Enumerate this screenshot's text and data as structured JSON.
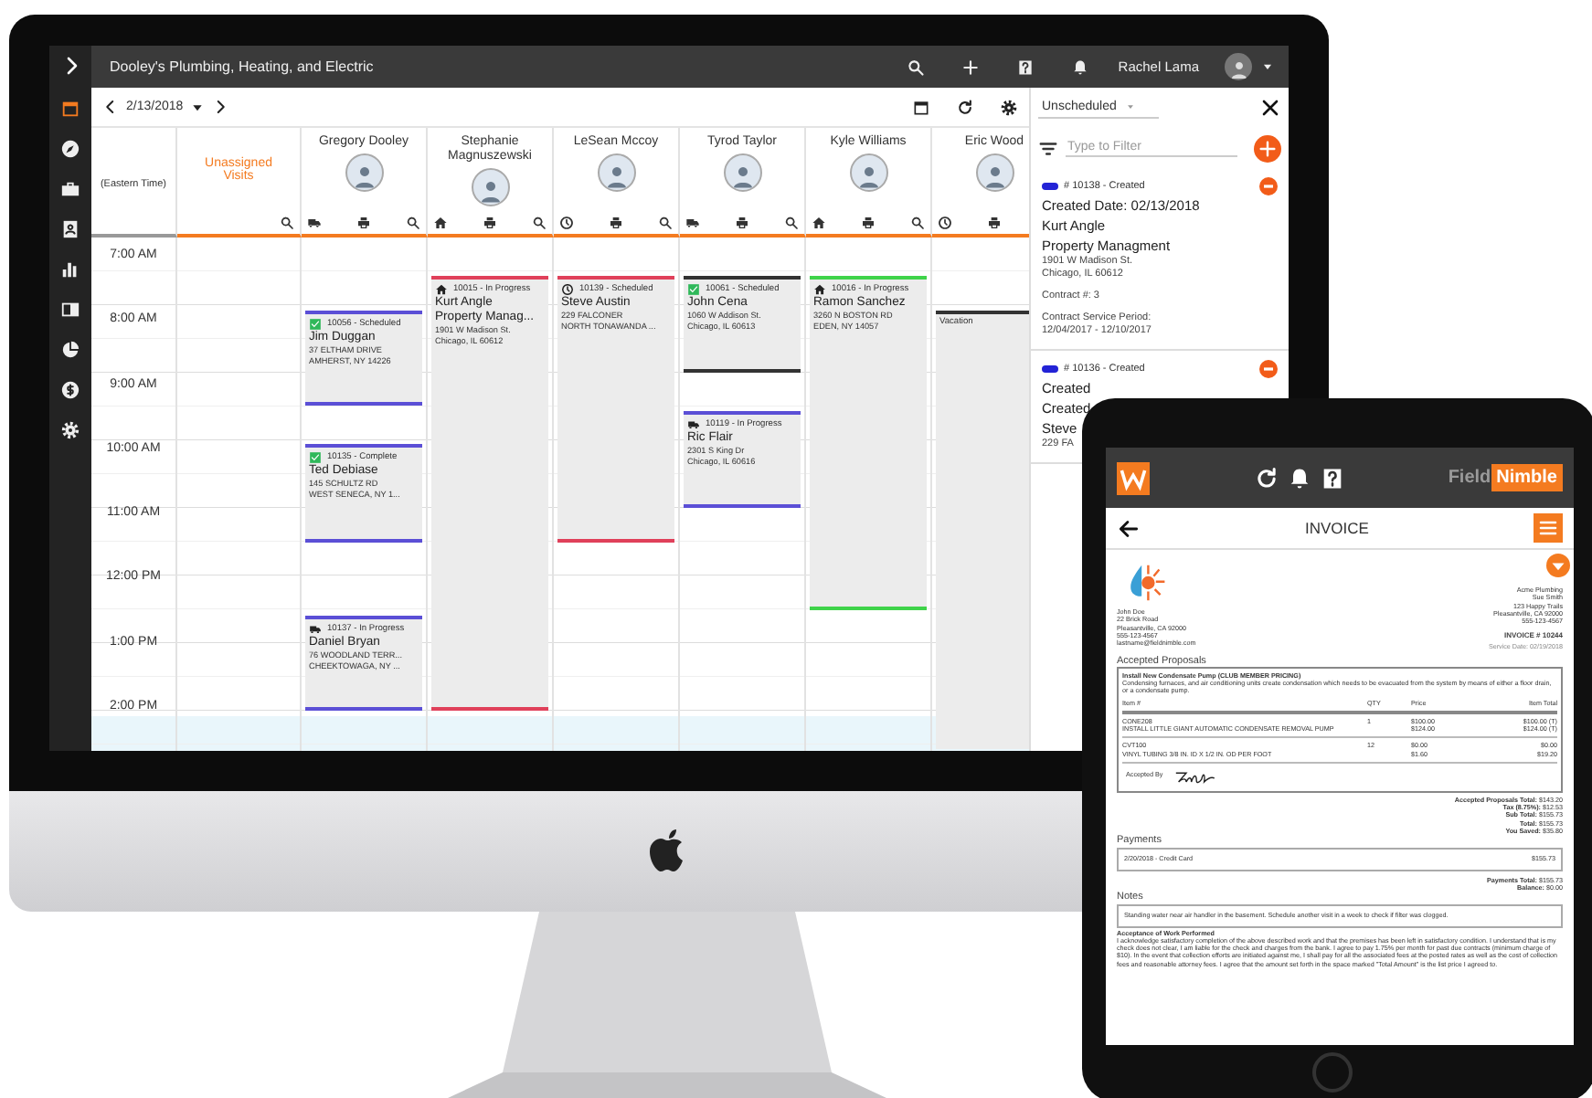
{
  "desktop": {
    "window": {
      "title": "Dooley's Plumbing, Heating, and Electric",
      "user": "Rachel Lama"
    },
    "sidebar": {
      "items": [
        {
          "kind": "calendar",
          "selected": true
        },
        {
          "kind": "compass",
          "selected": false
        },
        {
          "kind": "briefcase",
          "selected": false
        },
        {
          "kind": "contact",
          "selected": false
        },
        {
          "kind": "barchart",
          "selected": false
        },
        {
          "kind": "book",
          "selected": false
        },
        {
          "kind": "pie",
          "selected": false
        },
        {
          "kind": "dollar",
          "selected": false
        },
        {
          "kind": "gear",
          "selected": false
        }
      ]
    },
    "toolbar": {
      "date": "2/13/2018"
    },
    "calendar": {
      "time_header": "(Eastern Time)",
      "unassigned_header": "Unassigned Visits",
      "times": [
        "7:00 AM",
        "8:00 AM",
        "9:00 AM",
        "10:00 AM",
        "11:00 AM",
        "12:00 PM",
        "1:00 PM",
        "2:00 PM"
      ],
      "technicians": [
        {
          "name": "Gregory Dooley",
          "kind": "truck",
          "events": [
            {
              "kind": "check",
              "status": "10056 - Scheduled",
              "names": [
                "Jim Duggan"
              ],
              "lines": [
                "37 ELTHAM DRIVE",
                "AMHERST, NY 14226"
              ],
              "color": "#5b4fd6"
            },
            {
              "kind": "check",
              "status": "10135 - Complete",
              "names": [
                "Ted Debiase"
              ],
              "lines": [
                "145 SCHULTZ RD",
                "WEST SENECA, NY 1..."
              ],
              "color": "#5b4fd6"
            },
            {
              "kind": "truck",
              "status": "10137 - In Progress",
              "names": [
                "Daniel Bryan"
              ],
              "lines": [
                "76 WOODLAND TERR...",
                "CHEEKTOWAGA, NY ..."
              ],
              "color": "#5b4fd6"
            }
          ]
        },
        {
          "name": "Stephanie Magnuszewski",
          "kind": "house",
          "events": [
            {
              "kind": "house",
              "status": "10015 - In Progress",
              "names": [
                "Kurt Angle",
                "Property Manag..."
              ],
              "lines": [
                "1901 W Madison St.",
                "Chicago, IL 60612"
              ],
              "color": "#e0405a"
            }
          ]
        },
        {
          "name": "LeSean Mccoy",
          "kind": "clock",
          "events": [
            {
              "kind": "clock",
              "status": "10139 - Scheduled",
              "names": [
                "Steve Austin"
              ],
              "lines": [
                "229 FALCONER",
                "NORTH TONAWANDA ..."
              ],
              "color": "#e0405a"
            }
          ]
        },
        {
          "name": "Tyrod Taylor",
          "kind": "truck",
          "events": [
            {
              "kind": "check",
              "status": "10061 - Scheduled",
              "names": [
                "John Cena"
              ],
              "lines": [
                "1060 W Addison St.",
                "Chicago, IL 60613"
              ],
              "color": "#333333"
            },
            {
              "kind": "truck",
              "status": "10119 - In Progress",
              "names": [
                "Ric Flair"
              ],
              "lines": [
                "2301 S King Dr",
                "Chicago, IL 60616"
              ],
              "color": "#5b4fd6"
            }
          ]
        },
        {
          "name": "Kyle Williams",
          "kind": "house",
          "events": [
            {
              "kind": "house",
              "status": "10016 - In Progress",
              "names": [
                "Ramon Sanchez"
              ],
              "lines": [
                "3260 N BOSTON RD",
                "EDEN, NY 14057"
              ],
              "color": "#3fd34a"
            }
          ]
        },
        {
          "name": "Eric Wood",
          "kind": "clock",
          "events": [
            {
              "kind": "note",
              "status": "Vacation",
              "color": "#333333"
            }
          ]
        }
      ]
    },
    "panel": {
      "filter": "Unscheduled",
      "search": {
        "placeholder": "Type to Filter"
      },
      "cards": [
        {
          "number": "# 10138 - Created",
          "lines": [
            "Created Date: 02/13/2018",
            "Kurt Angle",
            "Property Managment"
          ],
          "address": [
            "1901 W Madison St.",
            "Chicago, IL 60612"
          ],
          "contract": "Contract #: 3",
          "period": [
            "Contract Service Period:",
            "12/04/2017 - 12/10/2017"
          ]
        },
        {
          "number": "# 10136 - Created",
          "lines": [
            "Created",
            "Created",
            "Steve"
          ],
          "address": [
            "229 FA"
          ]
        }
      ]
    }
  },
  "tablet": {
    "brand": [
      "Field",
      "Nimble"
    ],
    "title": "INVOICE",
    "customer": [
      "John Doe",
      "22 Brick Road",
      "Pleasantville, CA 92000",
      "555-123-4567",
      "lastname@fieldnimble.com"
    ],
    "company": [
      "Acme Plumbing",
      "Sue Smith",
      "123 Happy Trails",
      "Pleasantville, CA 92000",
      "555-123-4567"
    ],
    "invoice_number": "INVOICE # 10244",
    "service_date": "Service Date: 02/19/2018",
    "proposals_heading": "Accepted Proposals",
    "proposal": {
      "title": "Install New Condensate Pump (CLUB MEMBER PRICING)",
      "description": "Condensing furnaces, and air conditioning units create condensation which needs to be evacuated from the system by means of either a floor drain, or a condensate pump.",
      "columns": [
        "Item #",
        "QTY",
        "Price",
        "Item Total"
      ],
      "rows": [
        {
          "item": [
            "CONE208",
            "INSTALL LITTLE GIANT AUTOMATIC CONDENSATE REMOVAL PUMP"
          ],
          "qty": "1",
          "price": [
            "$100.00",
            "$124.00"
          ],
          "total": [
            "$100.00 (T)",
            "$124.00 (T)"
          ]
        },
        {
          "item": [
            "CVT100",
            "VINYL TUBING 3/8 IN. ID X 1/2 IN. OD PER FOOT"
          ],
          "qty": "12",
          "price": [
            "$0.00",
            "$1.60"
          ],
          "total": [
            "$0.00",
            "$19.20"
          ]
        }
      ],
      "accepted_by": "Accepted By"
    },
    "totals": [
      {
        "label": "Accepted Proposals Total:",
        "value": "$143.20"
      },
      {
        "label": "Tax (8.75%):",
        "value": "$12.53"
      },
      {
        "label": "Sub Total:",
        "value": "$155.73"
      },
      {
        "label": "Total:",
        "value": "$155.73"
      },
      {
        "label": "You Saved:",
        "value": "$35.80"
      }
    ],
    "payments_heading": "Payments",
    "payment": {
      "label": "2/20/2018 - Credit Card",
      "value": "$155.73"
    },
    "payment_totals": [
      {
        "label": "Payments Total:",
        "value": "$155.73"
      },
      {
        "label": "Balance:",
        "value": "$0.00"
      }
    ],
    "notes_heading": "Notes",
    "note": "Standing water near air handler in the basement.  Schedule another visit in a week to check if filter was clogged.",
    "acceptance_heading": "Acceptance of Work Performed",
    "acceptance": "I acknowledge satisfactory completion of the above described work and that the premises has been left in satisfactory condition. I understand that is my check does not clear, I am liable for the check and charges from the bank. I agree to pay 1.75% per month for past due contracts (minimum charge of $10). In the event that collection efforts are initiated against me, I shall pay for all the associated fees at the posted rates as well as the cost of collection fees and reasonable attorney fees. I agree that the amount set forth in the space marked \"Total Amount\" is the list price I agreed to."
  }
}
